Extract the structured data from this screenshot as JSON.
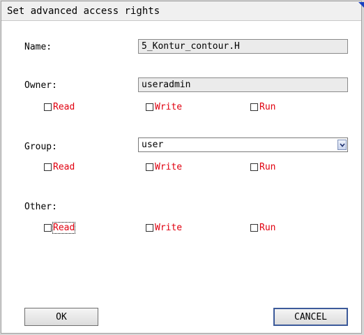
{
  "dialog": {
    "title": "Set advanced access rights",
    "name": {
      "label": "Name:",
      "value": "5_Kontur_contour.H"
    },
    "owner": {
      "label": "Owner:",
      "value": "useradmin",
      "read": "Read",
      "write": "Write",
      "run": "Run"
    },
    "group": {
      "label": "Group:",
      "value": "user",
      "read": "Read",
      "write": "Write",
      "run": "Run"
    },
    "other": {
      "label": "Other:",
      "read": "Read",
      "write": "Write",
      "run": "Run"
    },
    "ok_label": "OK",
    "cancel_label": "CANCEL"
  },
  "colors": {
    "checkbox_label": "#e0000f",
    "field_readonly": "#ebebeb",
    "corner_accent": "#1a3fc0"
  },
  "icons": [
    "chevron-down-icon",
    "checkbox-icon"
  ]
}
